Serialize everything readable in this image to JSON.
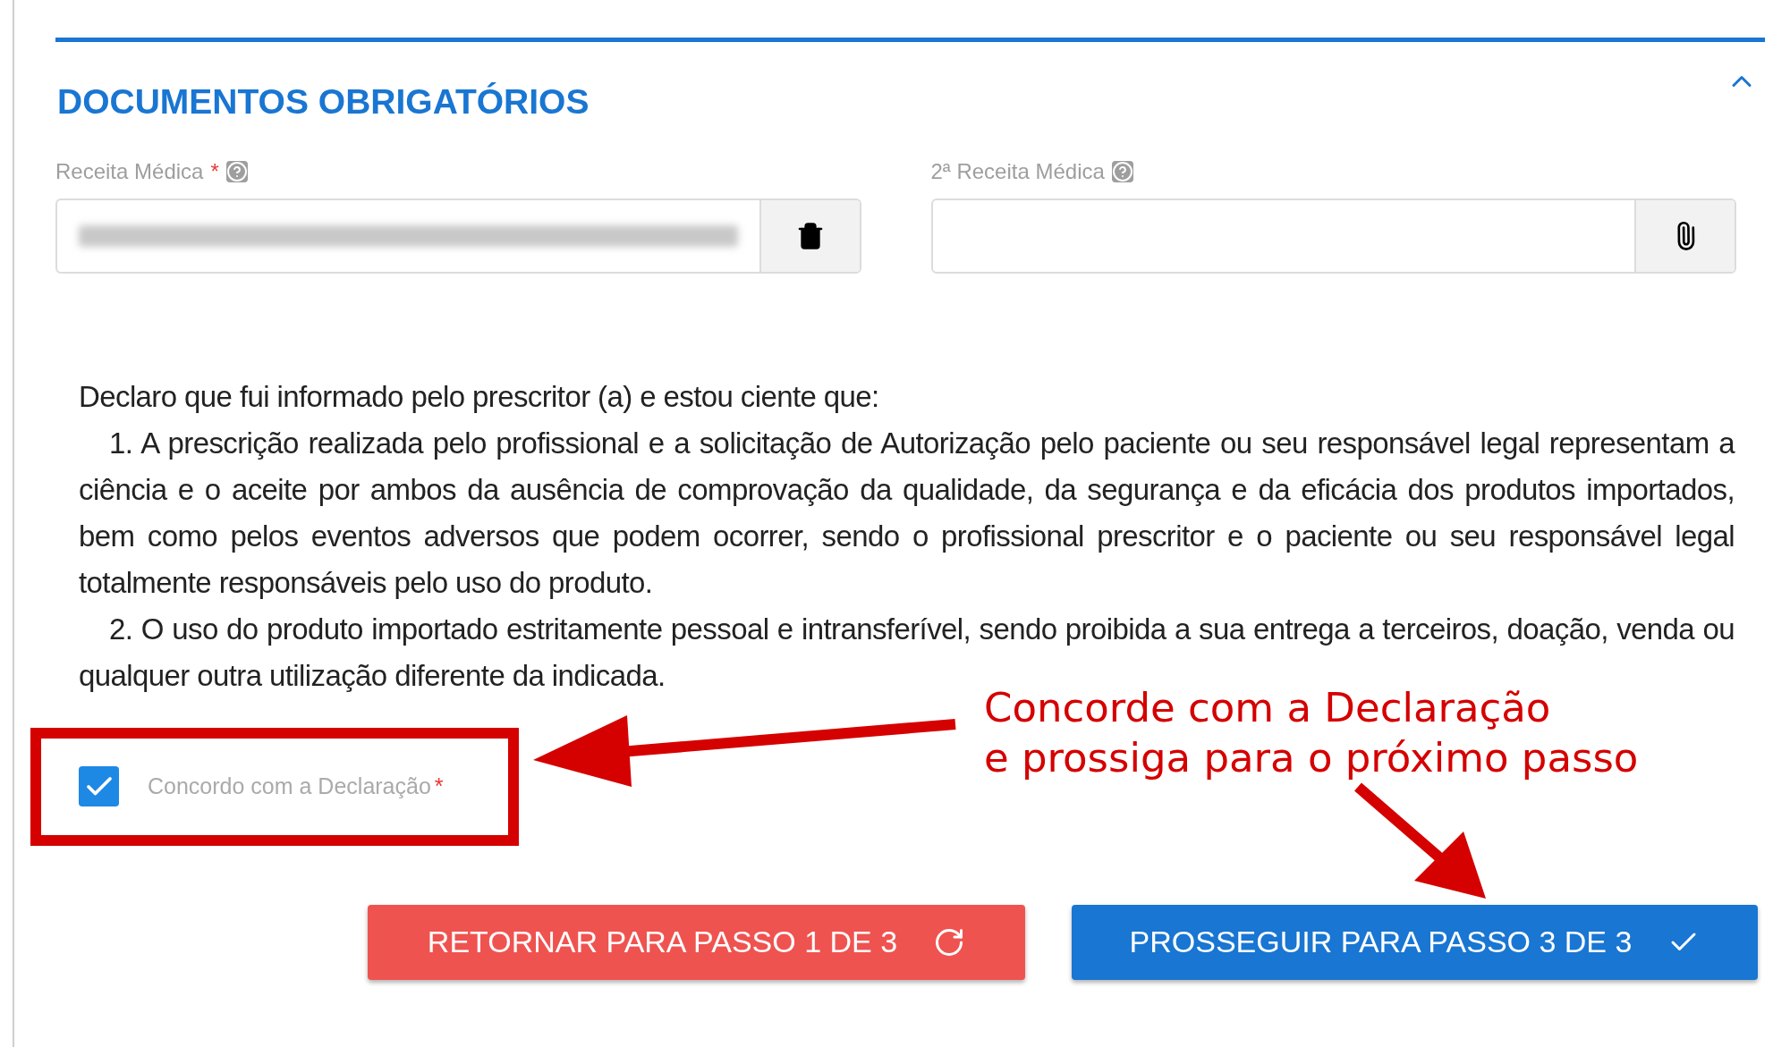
{
  "section": {
    "title": "DOCUMENTOS OBRIGATÓRIOS",
    "expanded": true
  },
  "fields": [
    {
      "label": "Receita Médica",
      "required_mark": "*",
      "filled": true,
      "kind": "delete"
    },
    {
      "label": "2ª Receita Médica",
      "filled": false,
      "kind": "attach"
    }
  ],
  "declaration": {
    "intro": "Declaro que fui informado pelo prescritor (a) e estou ciente que:",
    "items": [
      "1. A prescrição realizada pelo profissional e a solicitação de Autorização pelo paciente ou seu responsável legal representam a ciência e o aceite por ambos da ausência de comprovação da qualidade, da segurança e da eficácia dos produtos importados, bem como pelos eventos adversos que podem ocorrer, sendo o profissional prescritor e o paciente ou seu responsável legal totalmente responsáveis pelo uso do produto.",
      "2. O uso do produto importado estritamente pessoal e intransferível, sendo proibida a sua entrega a terceiros, doação, venda ou qualquer outra utilização diferente da indicada."
    ]
  },
  "agreement": {
    "label": "Concordo com a Declaração",
    "required_mark": "*",
    "checked": true
  },
  "annotation": {
    "lines": [
      "Concorde com a Declaração",
      "e prossiga para o próximo passo"
    ]
  },
  "buttons": [
    {
      "label": "RETORNAR PARA PASSO 1 DE 3",
      "kind": "back"
    },
    {
      "label": "PROSSEGUIR PARA PASSO 3 DE 3",
      "kind": "next"
    }
  ]
}
